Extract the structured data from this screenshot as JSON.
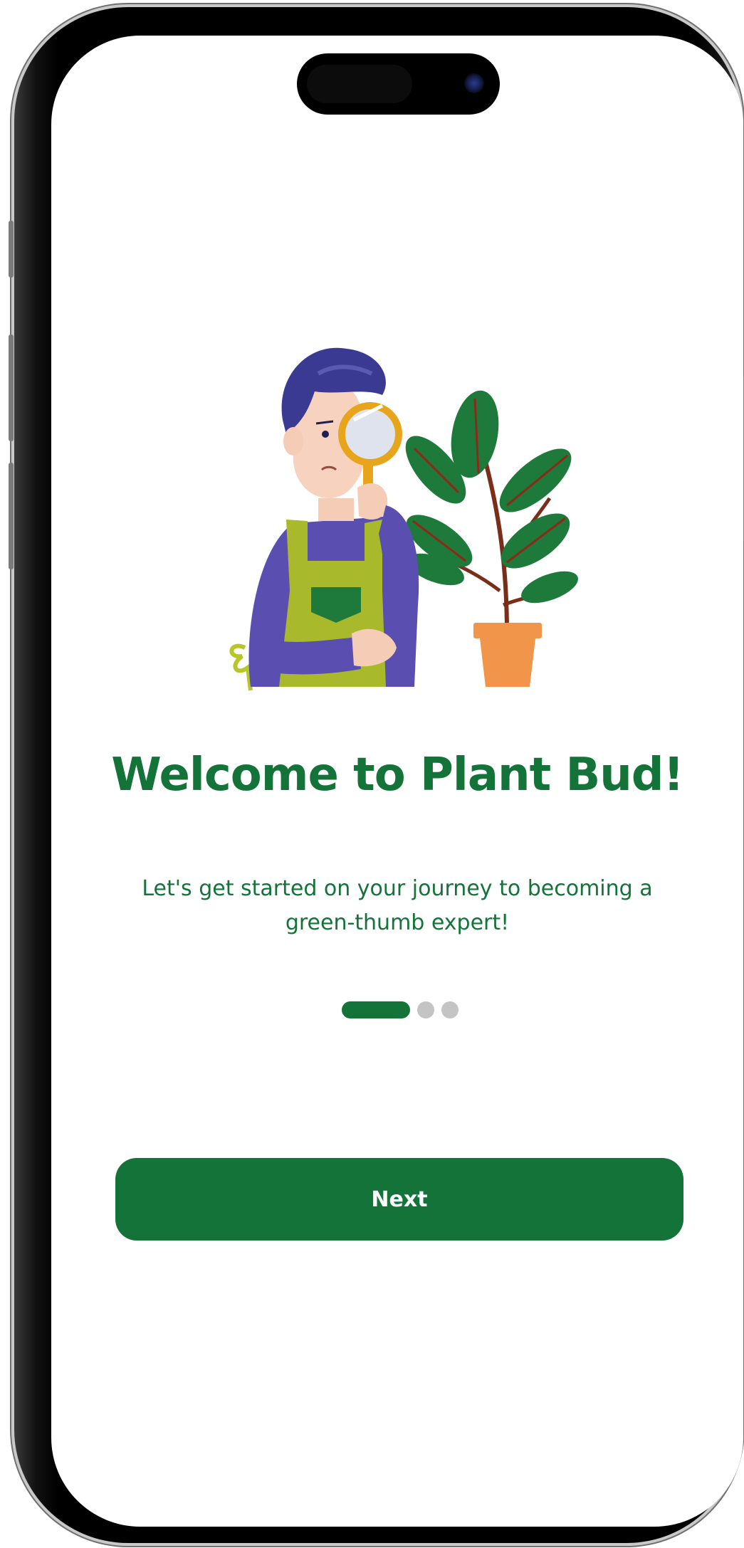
{
  "onboarding": {
    "title": "Welcome to Plant Bud!",
    "subtitle": "Let's get started on your journey to becoming a green-thumb expert!",
    "pager": {
      "total_pages": 3,
      "current_page": 1
    },
    "next_label": "Next"
  },
  "colors": {
    "brand_green": "#137339",
    "inactive_dot": "#c4c4c4",
    "background": "#ffffff"
  },
  "illustration": {
    "icon": "gardener-with-magnifier-and-plant-illustration"
  }
}
